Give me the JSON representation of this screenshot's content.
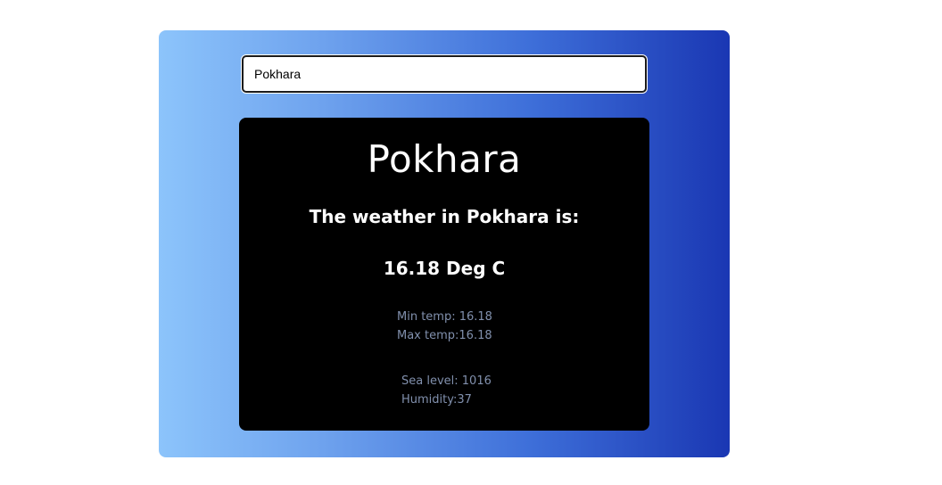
{
  "search": {
    "value": "Pokhara",
    "placeholder": ""
  },
  "weather": {
    "city": "Pokhara",
    "heading": "The weather in Pokhara is:",
    "temperature": "16.18 Deg C",
    "min_temp": "Min temp: 16.18",
    "max_temp": "Max temp:16.18",
    "sea_level": "Sea level: 1016",
    "humidity": "Humidity:37"
  },
  "colors": {
    "gradient_start": "#8cc4fb",
    "gradient_end": "#1a37b3",
    "card_background": "#000000",
    "muted_text": "#8190ad"
  }
}
